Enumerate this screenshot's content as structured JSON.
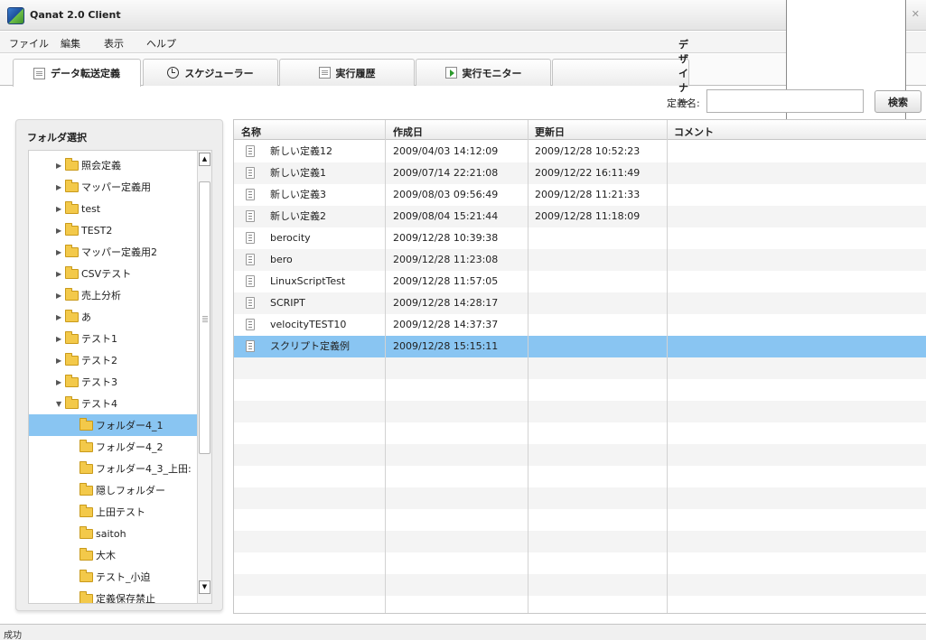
{
  "window": {
    "title": "Qanat 2.0 Client",
    "controls": "_ □ ✕"
  },
  "menu": [
    "ファイル",
    "編集",
    "表示",
    "ヘルプ"
  ],
  "tabs": [
    {
      "label": "データ転送定義",
      "icon": "document-icon"
    },
    {
      "label": "スケジューラー",
      "icon": "clock-icon"
    },
    {
      "label": "実行履歴",
      "icon": "history-icon"
    },
    {
      "label": "実行モニター",
      "icon": "play-icon"
    },
    {
      "label": "デザイナー",
      "icon": "designer-icon"
    }
  ],
  "search": {
    "label": "定義名:",
    "value": "",
    "button": "検索"
  },
  "folder_panel": {
    "title": "フォルダ選択",
    "items": [
      {
        "label": "照会定義",
        "expanded": false
      },
      {
        "label": "マッパー定義用",
        "expanded": false
      },
      {
        "label": "test",
        "expanded": false
      },
      {
        "label": "TEST2",
        "expanded": false
      },
      {
        "label": "マッパー定義用2",
        "expanded": false
      },
      {
        "label": "CSVテスト",
        "expanded": false
      },
      {
        "label": "売上分析",
        "expanded": false
      },
      {
        "label": "あ",
        "expanded": false
      },
      {
        "label": "テスト1",
        "expanded": false
      },
      {
        "label": "テスト2",
        "expanded": false
      },
      {
        "label": "テスト3",
        "expanded": false
      },
      {
        "label": "テスト4",
        "expanded": true
      },
      {
        "label": "フォルダー4_1",
        "child": true,
        "selected": true
      },
      {
        "label": "フォルダー4_2",
        "child": true
      },
      {
        "label": "フォルダー4_3_上田:",
        "child": true
      },
      {
        "label": "隠しフォルダー",
        "child": true
      },
      {
        "label": "上田テスト",
        "child": true
      },
      {
        "label": "saitoh",
        "child": true
      },
      {
        "label": "大木",
        "child": true
      },
      {
        "label": "テスト_小迫",
        "child": true
      },
      {
        "label": "定義保存禁止",
        "child": true
      }
    ]
  },
  "table": {
    "columns": [
      "名称",
      "作成日",
      "更新日",
      "コメント"
    ],
    "rows": [
      {
        "name": "新しい定義12",
        "created": "2009/04/03 14:12:09",
        "updated": "2009/12/28 10:52:23",
        "comment": ""
      },
      {
        "name": "新しい定義1",
        "created": "2009/07/14 22:21:08",
        "updated": "2009/12/22 16:11:49",
        "comment": ""
      },
      {
        "name": "新しい定義3",
        "created": "2009/08/03 09:56:49",
        "updated": "2009/12/28 11:21:33",
        "comment": ""
      },
      {
        "name": "新しい定義2",
        "created": "2009/08/04 15:21:44",
        "updated": "2009/12/28 11:18:09",
        "comment": ""
      },
      {
        "name": "berocity",
        "created": "2009/12/28 10:39:38",
        "updated": "",
        "comment": ""
      },
      {
        "name": "bero",
        "created": "2009/12/28 11:23:08",
        "updated": "",
        "comment": ""
      },
      {
        "name": "LinuxScriptTest",
        "created": "2009/12/28 11:57:05",
        "updated": "",
        "comment": ""
      },
      {
        "name": "SCRIPT",
        "created": "2009/12/28 14:28:17",
        "updated": "",
        "comment": ""
      },
      {
        "name": "velocityTEST10",
        "created": "2009/12/28 14:37:37",
        "updated": "",
        "comment": ""
      },
      {
        "name": "スクリプト定義例",
        "created": "2009/12/28 15:15:11",
        "updated": "",
        "comment": "",
        "selected": true
      }
    ]
  },
  "status": "成功",
  "colors": {
    "selection": "#89c5f2",
    "folder": "#f3c94a"
  }
}
